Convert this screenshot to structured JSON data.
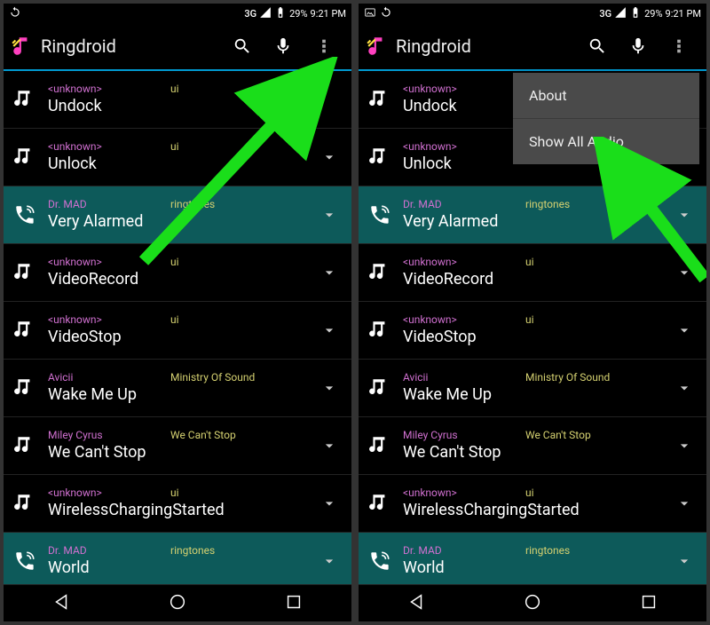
{
  "status": {
    "network": "3G",
    "battery": "29%",
    "time": "9:21 PM"
  },
  "toolbar": {
    "title": "Ringdroid"
  },
  "rows": [
    {
      "artist": "<unknown>",
      "album": "ui",
      "title": "Undock",
      "ringtone": false,
      "expand": false
    },
    {
      "artist": "<unknown>",
      "album": "ui",
      "title": "Unlock",
      "ringtone": false,
      "expand": true
    },
    {
      "artist": "Dr. MAD",
      "album": "ringtones",
      "title": "Very Alarmed",
      "ringtone": true,
      "expand": true
    },
    {
      "artist": "<unknown>",
      "album": "ui",
      "title": "VideoRecord",
      "ringtone": false,
      "expand": true
    },
    {
      "artist": "<unknown>",
      "album": "ui",
      "title": "VideoStop",
      "ringtone": false,
      "expand": true
    },
    {
      "artist": "Avicii",
      "album": "Ministry Of Sound",
      "title": "Wake Me Up",
      "ringtone": false,
      "expand": true
    },
    {
      "artist": "Miley Cyrus",
      "album": "We Can't Stop",
      "title": "We Can't Stop",
      "ringtone": false,
      "expand": true
    },
    {
      "artist": "<unknown>",
      "album": "ui",
      "title": "WirelessChargingStarted",
      "ringtone": false,
      "expand": true
    },
    {
      "artist": "Dr. MAD",
      "album": "ringtones",
      "title": "World",
      "ringtone": true,
      "expand": true
    }
  ],
  "menu": {
    "items": [
      {
        "label": "About"
      },
      {
        "label": "Show All Audio"
      }
    ]
  }
}
